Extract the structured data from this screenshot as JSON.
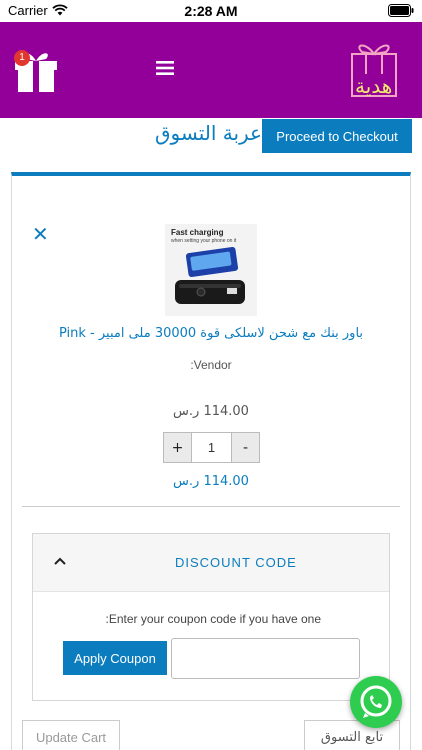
{
  "status_bar": {
    "carrier": "Carrier",
    "time": "2:28 AM"
  },
  "header": {
    "cart_badge": "1",
    "logo_text": "هدية"
  },
  "page": {
    "title": "عربة التسوق",
    "checkout_label": "Proceed to Checkout"
  },
  "cart_item": {
    "image_caption": "Fast charging",
    "image_subcaption": "when setting your phone on it",
    "name": "باور بنك مع شحن لاسلكى قوة 30000 ملى امبير - Pink",
    "vendor_label": ":Vendor",
    "unit_price": "114.00 ر.س",
    "quantity": "1",
    "line_total": "114.00 ر.س"
  },
  "discount": {
    "title": "DISCOUNT CODE",
    "hint": ":Enter your coupon code if you have one",
    "apply_label": "Apply Coupon",
    "input_value": ""
  },
  "actions": {
    "update_label": "Update Cart",
    "continue_label": "تابع التسوق"
  },
  "colors": {
    "header": "#930099",
    "accent": "#0b7dbf",
    "whatsapp": "#2ecc4f",
    "badge": "#e2372f"
  },
  "icons": [
    "wifi-icon",
    "battery-icon",
    "gift-cart-icon",
    "hamburger-menu-icon",
    "gift-logo-icon",
    "close-icon",
    "chevron-up-icon",
    "whatsapp-icon"
  ]
}
